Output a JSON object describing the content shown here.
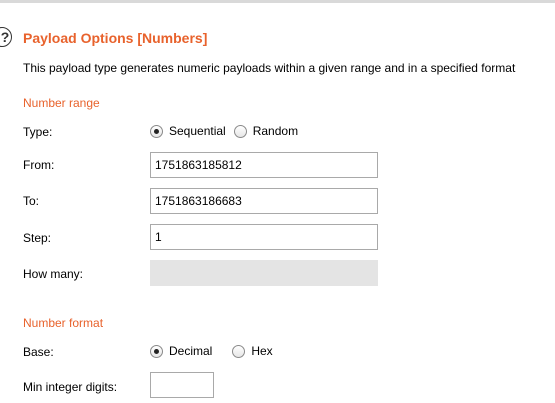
{
  "panel": {
    "title": "Payload Options [Numbers]",
    "description": "This payload type generates numeric payloads within a given range and in a specified format"
  },
  "number_range": {
    "title": "Number range",
    "type": {
      "label": "Type:",
      "options": [
        "Sequential",
        "Random"
      ],
      "selected": "Sequential"
    },
    "from": {
      "label": "From:",
      "value": "1751863185812"
    },
    "to": {
      "label": "To:",
      "value": "1751863186683"
    },
    "step": {
      "label": "Step:",
      "value": "1"
    },
    "how_many": {
      "label": "How many:",
      "value": ""
    }
  },
  "number_format": {
    "title": "Number format",
    "base": {
      "label": "Base:",
      "options": [
        "Decimal",
        "Hex"
      ],
      "selected": "Decimal"
    },
    "min_integer_digits": {
      "label": "Min integer digits:",
      "value": ""
    }
  },
  "colors": {
    "accent": "#e8622c"
  },
  "icons": {
    "help": "help-icon"
  }
}
